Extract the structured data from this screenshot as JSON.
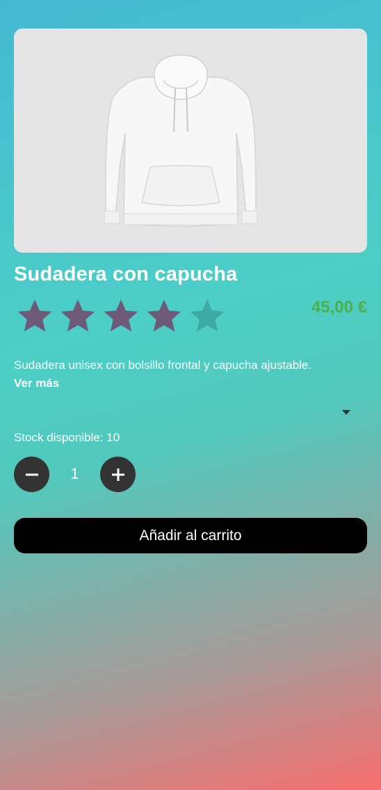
{
  "product": {
    "image_alt": "Sudadera blanca con capucha",
    "title": "Sudadera con capucha",
    "price": "45,00 €",
    "rating": 4,
    "rating_max": 5,
    "description": "Sudadera unisex con bolsillo frontal y capucha ajustable.",
    "more_label": "Ver más",
    "stock_label": "Stock disponible: 10"
  },
  "quantity": {
    "value": "1"
  },
  "cart": {
    "add_label": "Añadir al carrito"
  },
  "colors": {
    "star_filled": "#6c5a78",
    "star_empty": "#3fa9a4",
    "price": "#4caf50",
    "button": "#000000"
  },
  "icons": {
    "minus": "minus-icon",
    "plus": "plus-icon",
    "dropdown": "chevron-down-icon",
    "star": "star-icon"
  }
}
